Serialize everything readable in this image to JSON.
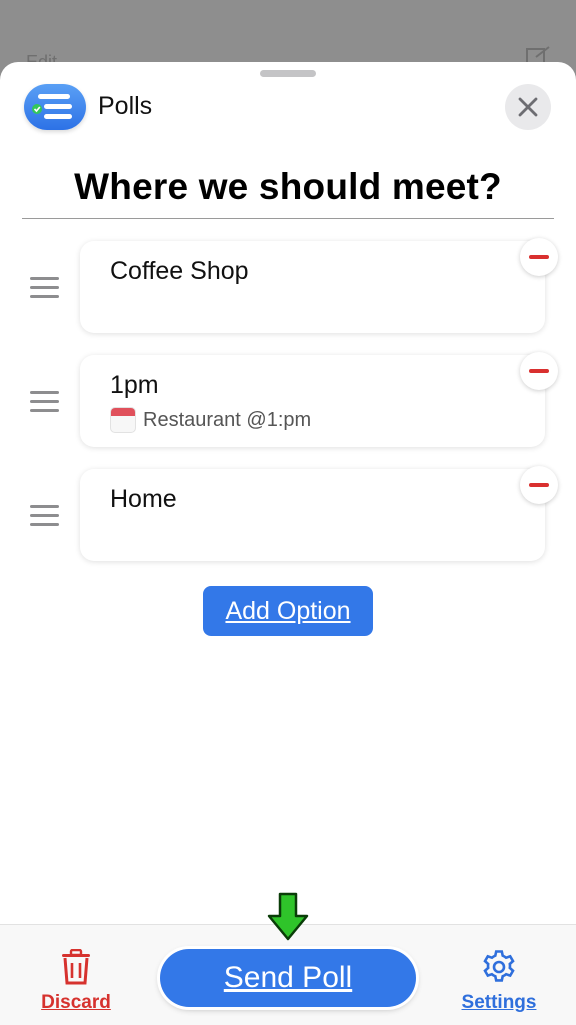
{
  "backdrop": {
    "edit_label": "Edit"
  },
  "header": {
    "app_title": "Polls",
    "app_icon": "polls-app-icon",
    "close_icon": "close-icon"
  },
  "poll": {
    "question": "Where we should meet?",
    "options": [
      {
        "text": "Coffee Shop",
        "subtitle": ""
      },
      {
        "text": "1pm",
        "subtitle": "Restaurant @1:pm",
        "subtitle_icon": "calendar-icon"
      },
      {
        "text": "Home",
        "subtitle": ""
      }
    ],
    "add_option_label": "Add Option"
  },
  "toolbar": {
    "discard_label": "Discard",
    "discard_icon": "trash-icon",
    "send_label": "Send Poll",
    "settings_label": "Settings",
    "settings_icon": "gear-icon"
  },
  "colors": {
    "accent_blue": "#3378e8",
    "destructive_red": "#d6322e",
    "pointer_green": "#2fc42a"
  }
}
